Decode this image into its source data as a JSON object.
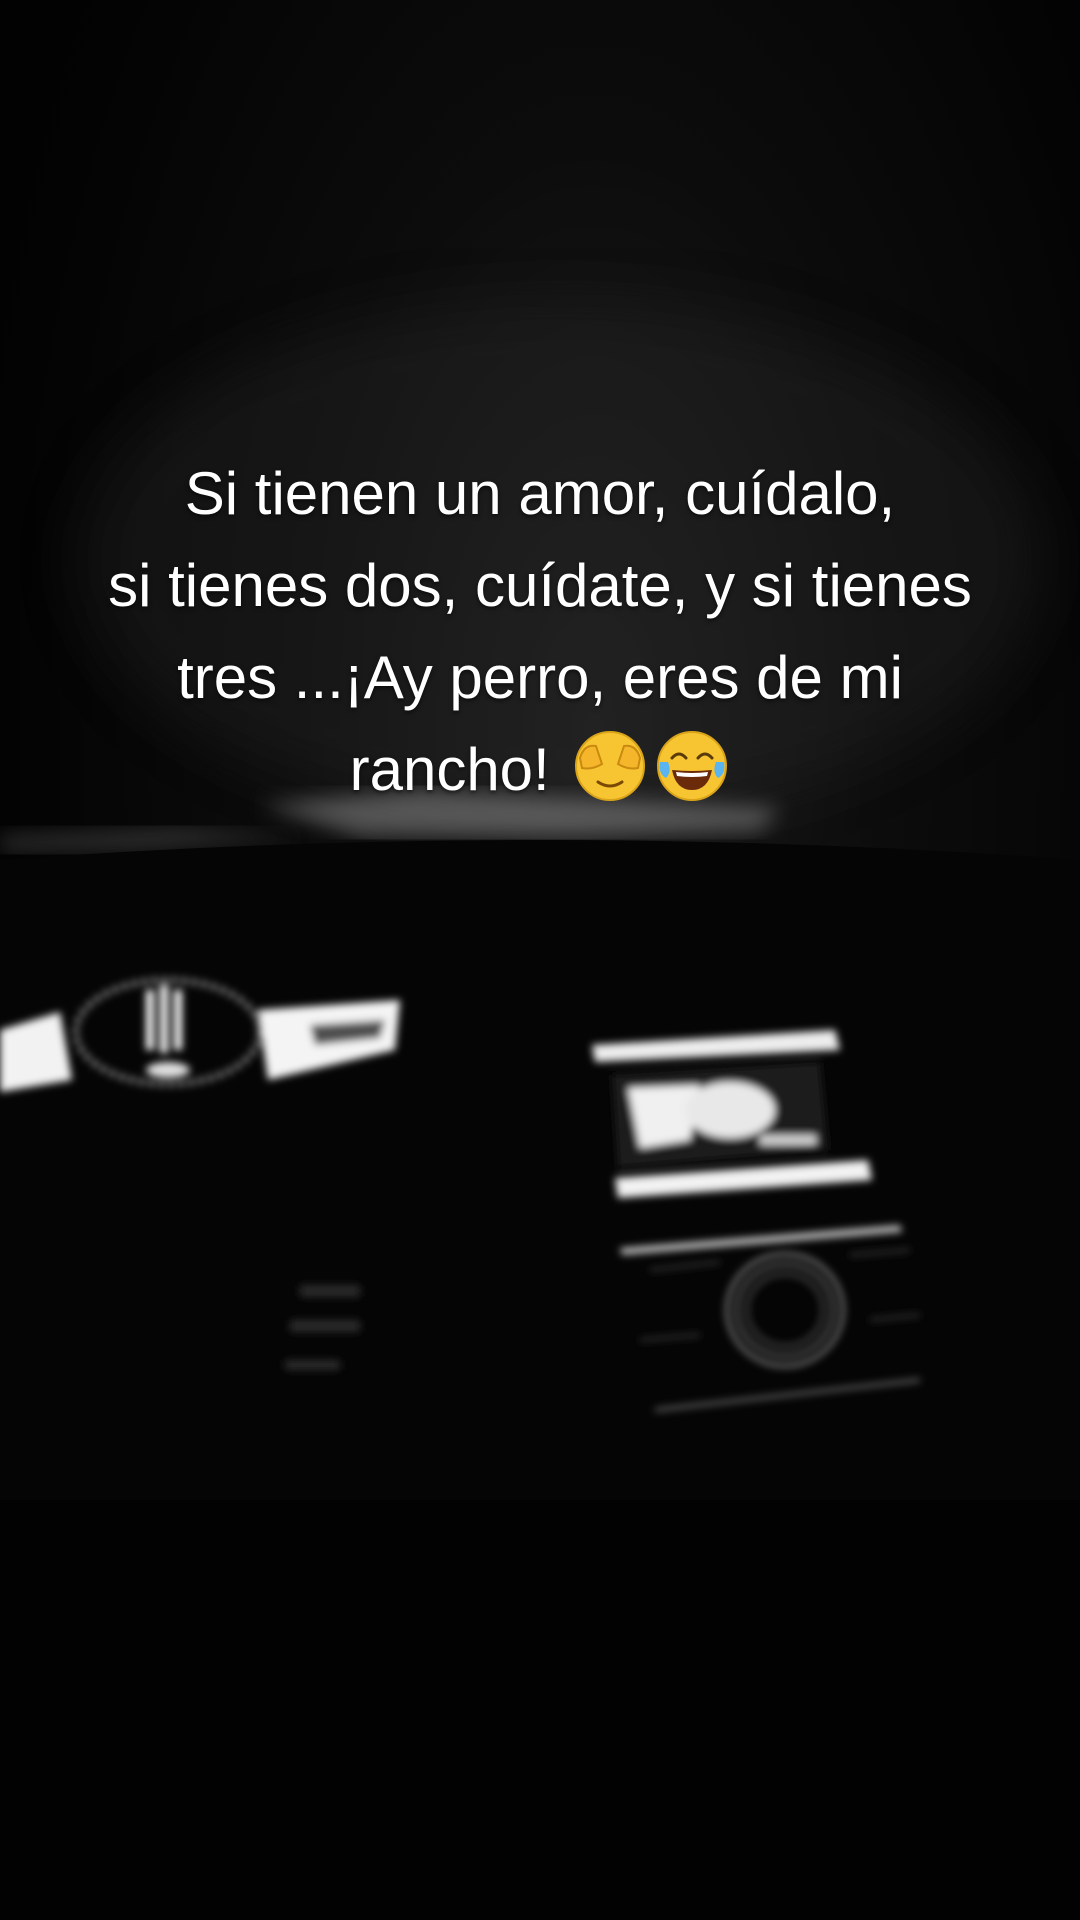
{
  "caption": {
    "line1": "Si tienen un amor, cuídalo,",
    "line2": "si tienes dos, cuídate, y si tienes",
    "line3": "tres ...¡Ay perro, eres de mi",
    "line4": "rancho!"
  },
  "emojis": [
    "face-with-hand-over-mouth-icon",
    "face-with-tears-of-joy-icon"
  ],
  "colors": {
    "background": "#000000",
    "text": "#ffffff",
    "emoji_yellow": "#f7c531"
  }
}
